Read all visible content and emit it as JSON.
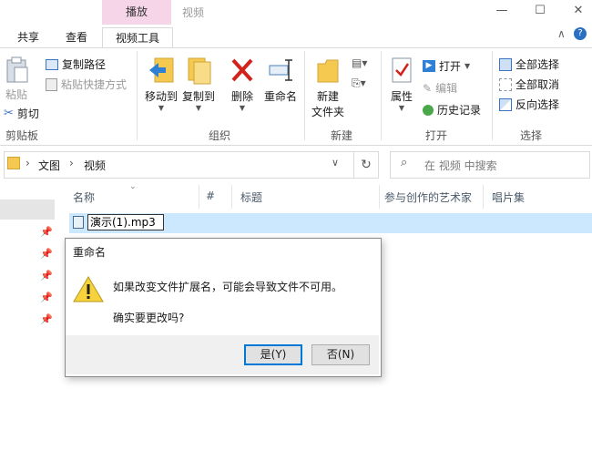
{
  "window": {
    "context_tab": "播放",
    "title": "视频",
    "buttons": [
      "—",
      "☐",
      "✕"
    ]
  },
  "tabs": [
    "共享",
    "查看",
    "视频工具"
  ],
  "ribbon": {
    "clipboard": {
      "paste": "粘贴",
      "copy_path": "复制路径",
      "paste_shortcut": "粘贴快捷方式",
      "cut": "剪切",
      "group": "剪贴板"
    },
    "organize": {
      "move_to": "移动到",
      "copy_to": "复制到",
      "delete": "删除",
      "rename": "重命名",
      "group": "组织"
    },
    "new": {
      "new_folder_line1": "新建",
      "new_folder_line2": "文件夹",
      "group": "新建"
    },
    "open": {
      "properties": "属性",
      "open": "打开",
      "edit": "编辑",
      "history": "历史记录",
      "group": "打开"
    },
    "select": {
      "select_all": "全部选择",
      "select_none": "全部取消",
      "invert": "反向选择",
      "group": "选择"
    }
  },
  "address": {
    "segments": [
      "文图",
      "视频"
    ],
    "search_placeholder": "在 视频 中搜索"
  },
  "columns": [
    "名称",
    "#",
    "标题",
    "参与创作的艺术家",
    "唱片集"
  ],
  "file": {
    "name_edit_value": "演示(1).mp3"
  },
  "dialog": {
    "title": "重命名",
    "message": "如果改变文件扩展名，可能会导致文件不可用。",
    "question": "确实要更改吗?",
    "yes": "是(Y)",
    "no": "否(N)"
  },
  "colors": {
    "context_tab_bg": "#f6d5e8",
    "selection_bg": "#cce8ff",
    "accent": "#0078d7"
  }
}
